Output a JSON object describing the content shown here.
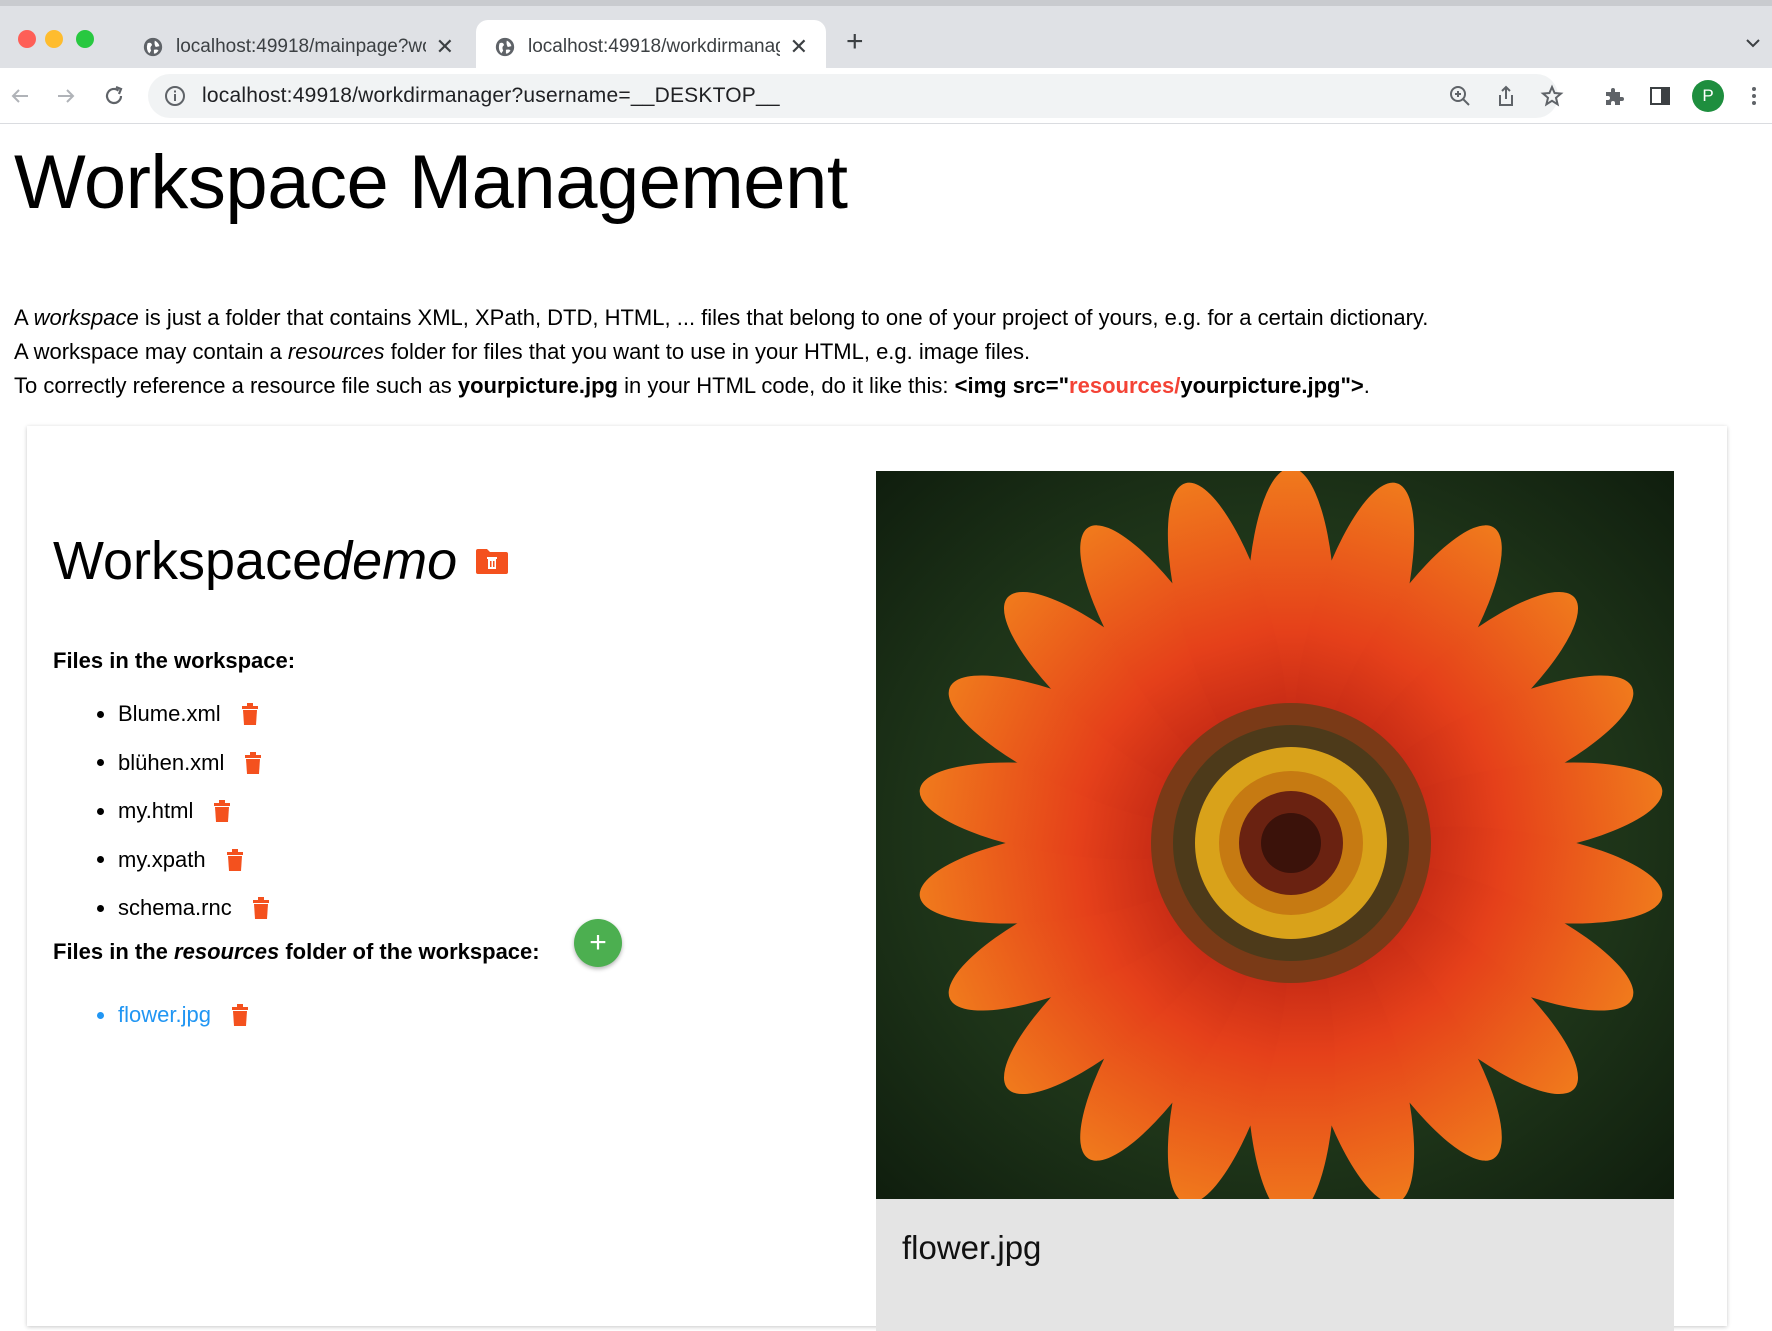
{
  "browser": {
    "tabs": [
      {
        "title": "localhost:49918/mainpage?workdir",
        "active": false
      },
      {
        "title": "localhost:49918/workdirmanager",
        "active": true
      }
    ],
    "new_tab_label": "+",
    "url": "localhost:49918/workdirmanager?username=__DESKTOP__",
    "profile_initial": "P",
    "close_glyph": "✕"
  },
  "page": {
    "title": "Workspace Management",
    "intro": {
      "line1_a": "A ",
      "line1_em": "workspace",
      "line1_b": " is just a folder that contains XML, XPath, DTD, HTML, ... files that belong to one of your project of yours, e.g. for a certain dictionary.",
      "line2_a": "A workspace may contain a ",
      "line2_em": "resources",
      "line2_b": " folder for files that you want to use in your HTML, e.g. image files.",
      "line3_a": "To correctly reference a resource file such as ",
      "line3_strong": "yourpicture.jpg",
      "line3_b": " in your HTML code, do it like this: ",
      "line3_code_a": "<img src=\"",
      "line3_code_red": "resources/",
      "line3_code_b": "yourpicture.jpg\">",
      "line3_end": "."
    }
  },
  "workspace": {
    "title_prefix": "Workspace ",
    "name": "demo",
    "files_label": "Files in the workspace:",
    "files": [
      {
        "name": "Blume.xml"
      },
      {
        "name": "blühen.xml"
      },
      {
        "name": "my.html"
      },
      {
        "name": "my.xpath"
      },
      {
        "name": "schema.rnc"
      }
    ],
    "resources_label_a": "Files in the ",
    "resources_label_em": "resources",
    "resources_label_b": " folder of the workspace:",
    "add_label": "+",
    "resources": [
      {
        "name": "flower.jpg"
      }
    ],
    "preview_caption": "flower.jpg"
  },
  "colors": {
    "accent_red": "#f44336",
    "trash_orange": "#f4511e",
    "add_green": "#4caf50",
    "link_blue": "#2196f3"
  },
  "icons": [
    "globe-icon",
    "close-icon",
    "back-arrow-icon",
    "forward-arrow-icon",
    "reload-icon",
    "info-icon",
    "zoom-icon",
    "share-icon",
    "star-icon",
    "extensions-icon",
    "side-panel-icon",
    "more-vert-icon",
    "trash-icon",
    "folder-delete-icon",
    "plus-icon"
  ]
}
